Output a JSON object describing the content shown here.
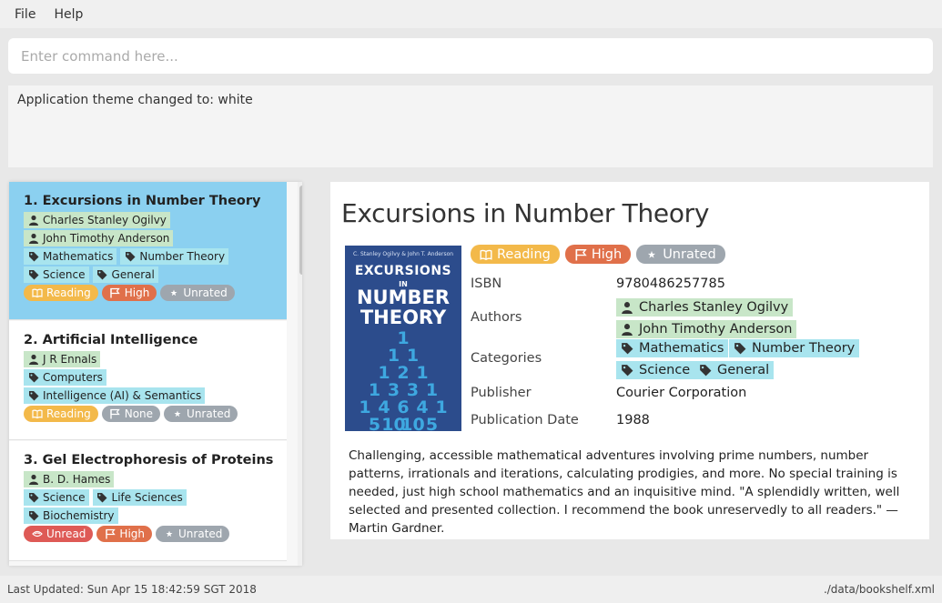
{
  "menu": {
    "file": "File",
    "help": "Help"
  },
  "command": {
    "placeholder": "Enter command here...",
    "value": ""
  },
  "result": {
    "message": "Application theme changed to: white"
  },
  "book_list": [
    {
      "title": "1. Excursions in Number Theory",
      "authors": [
        "Charles Stanley Ogilvy",
        "John Timothy Anderson"
      ],
      "category_rows": [
        [
          "Mathematics",
          "Number Theory"
        ],
        [
          "Science",
          "General"
        ]
      ],
      "status": "Reading",
      "priority": "High",
      "rating": "Unrated",
      "selected": true
    },
    {
      "title": "2. Artificial Intelligence",
      "authors": [
        "J R Ennals"
      ],
      "category_rows": [
        [
          "Computers"
        ],
        [
          "Intelligence (AI) & Semantics"
        ]
      ],
      "status": "Reading",
      "priority": "None",
      "rating": "Unrated",
      "selected": false
    },
    {
      "title": "3. Gel Electrophoresis of Proteins",
      "authors": [
        "B. D. Hames"
      ],
      "category_rows": [
        [
          "Science",
          "Life Sciences"
        ],
        [
          "Biochemistry"
        ]
      ],
      "status": "Unread",
      "priority": "High",
      "rating": "Unrated",
      "selected": false
    }
  ],
  "detail": {
    "title": "Excursions in Number Theory",
    "cover": {
      "authors_line": "C. Stanley Ogilvy & John T. Anderson",
      "line1": "EXCURSIONS",
      "line2": "IN",
      "line3": "NUMBER",
      "line4": "THEORY",
      "number_rows": [
        "1",
        "1 1",
        "1 2 1",
        "1 3 3 1",
        "1 4 6 4 1",
        "5 10 10 5"
      ],
      "color": "#2c4c8c"
    },
    "status": "Reading",
    "priority": "High",
    "rating": "Unrated",
    "labels": {
      "isbn": "ISBN",
      "authors": "Authors",
      "categories": "Categories",
      "publisher": "Publisher",
      "publication_date": "Publication Date"
    },
    "isbn": "9780486257785",
    "authors": [
      "Charles Stanley Ogilvy",
      "John Timothy Anderson"
    ],
    "categories": [
      "Mathematics",
      "Number Theory",
      "Science",
      "General"
    ],
    "publisher": "Courier Corporation",
    "publication_date": "1988",
    "description": "Challenging, accessible mathematical adventures involving prime numbers, number patterns, irrationals and iterations, calculating prodigies, and more. No special training is needed, just high school mathematics and an inquisitive mind. \"A splendidly written, well selected and presented collection. I recommend the book unreservedly to all readers.\" — Martin Gardner."
  },
  "statusbar": {
    "last_updated": "Last Updated: Sun Apr 15 18:42:59 SGT 2018",
    "file_path": "./data/bookshelf.xml"
  },
  "colors": {
    "selected_card": "#8bd0f0",
    "author_chip": "#c8e6c8",
    "category_chip": "#a8e4ee",
    "reading": "#f3b94a",
    "unread": "#de5a56",
    "high_priority": "#e0704a",
    "neutral": "#9ea6ae"
  },
  "icons": {
    "author": "person-icon",
    "category": "tag-icon",
    "reading": "open-book-icon",
    "unread": "closed-book-icon",
    "priority": "flag-icon",
    "rating": "star-icon"
  }
}
